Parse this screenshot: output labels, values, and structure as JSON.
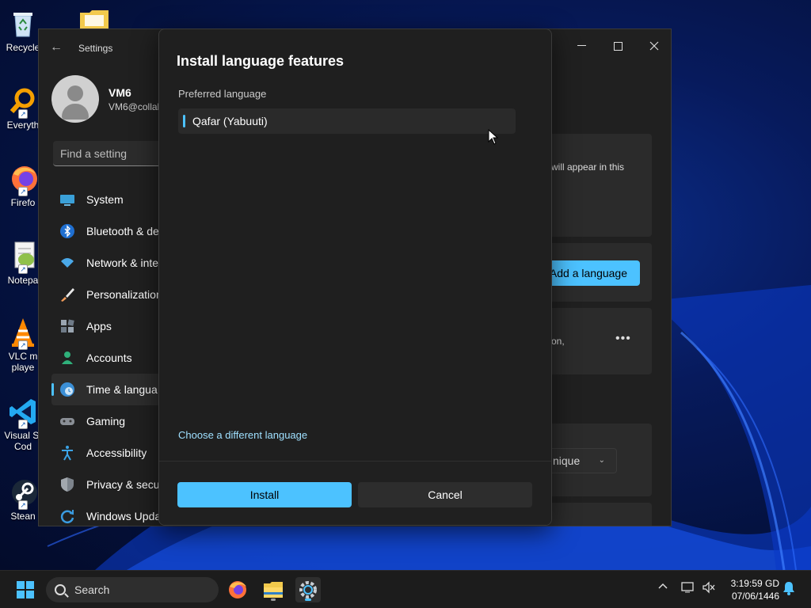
{
  "desktop": {
    "icons": [
      {
        "label": "Recycle",
        "icon": "recycle-bin-icon"
      },
      {
        "label": "Everyth",
        "icon": "everything-search-icon"
      },
      {
        "label": "Firefo",
        "icon": "firefox-icon"
      },
      {
        "label": "Notepa",
        "icon": "notepad-plus-plus-icon"
      },
      {
        "label": "VLC m\nplaye",
        "icon": "vlc-icon"
      },
      {
        "label": "Visual St\nCod",
        "icon": "vscode-icon"
      },
      {
        "label": "Stean",
        "icon": "steam-icon"
      }
    ],
    "folder_icon": "folder-icon"
  },
  "settings": {
    "title": "Settings",
    "user": {
      "name": "VM6",
      "email": "VM6@collal"
    },
    "search_placeholder": "Find a setting",
    "nav": [
      {
        "label": "System",
        "icon": "monitor-icon"
      },
      {
        "label": "Bluetooth & de",
        "icon": "bluetooth-icon"
      },
      {
        "label": "Network & inte",
        "icon": "wifi-icon"
      },
      {
        "label": "Personalization",
        "icon": "brush-icon"
      },
      {
        "label": "Apps",
        "icon": "apps-icon"
      },
      {
        "label": "Accounts",
        "icon": "person-icon"
      },
      {
        "label": "Time & langua",
        "icon": "globe-clock-icon",
        "selected": true
      },
      {
        "label": "Gaming",
        "icon": "gamepad-icon"
      },
      {
        "label": "Accessibility",
        "icon": "accessibility-icon"
      },
      {
        "label": "Privacy & secur",
        "icon": "shield-icon"
      },
      {
        "label": "Windows Upda",
        "icon": "update-icon"
      }
    ],
    "content": {
      "card1_text": "will appear in this",
      "add_language_label": "Add a language",
      "card3_text": "on,",
      "more_label": "•••",
      "dropdown_value": "nique"
    }
  },
  "dialog": {
    "title": "Install language features",
    "preferred_label": "Preferred language",
    "selected_language": "Qafar (Yabuuti)",
    "choose_link": "Choose a different language",
    "install_label": "Install",
    "cancel_label": "Cancel"
  },
  "taskbar": {
    "search_placeholder": "Search",
    "apps": [
      "start-icon",
      "firefox-icon",
      "file-explorer-icon",
      "settings-icon"
    ],
    "time": "3:19:59 GD",
    "date": "07/06/1446"
  },
  "colors": {
    "accent": "#4cc2ff",
    "link": "#9fe0ff",
    "window_bg": "#202020",
    "dialog_bg": "#1f1f1f"
  }
}
